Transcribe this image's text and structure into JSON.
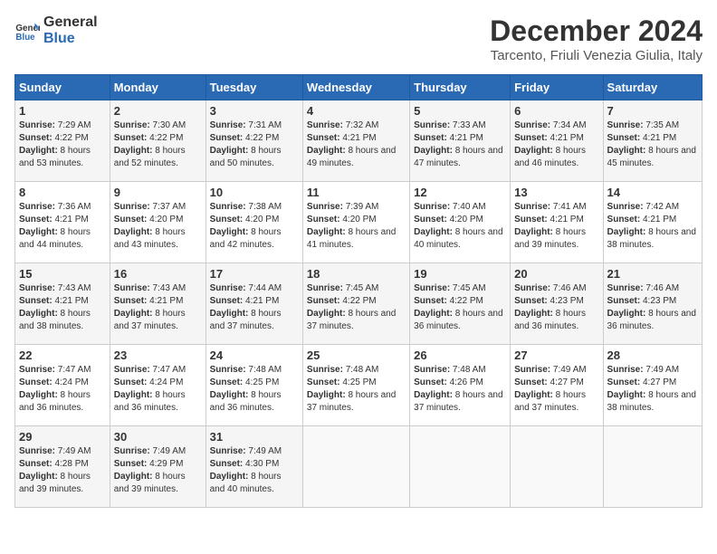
{
  "logo": {
    "line1": "General",
    "line2": "Blue"
  },
  "title": "December 2024",
  "subtitle": "Tarcento, Friuli Venezia Giulia, Italy",
  "days_header": [
    "Sunday",
    "Monday",
    "Tuesday",
    "Wednesday",
    "Thursday",
    "Friday",
    "Saturday"
  ],
  "weeks": [
    [
      {
        "day": "1",
        "sunrise": "7:29 AM",
        "sunset": "4:22 PM",
        "daylight": "8 hours and 53 minutes."
      },
      {
        "day": "2",
        "sunrise": "7:30 AM",
        "sunset": "4:22 PM",
        "daylight": "8 hours and 52 minutes."
      },
      {
        "day": "3",
        "sunrise": "7:31 AM",
        "sunset": "4:22 PM",
        "daylight": "8 hours and 50 minutes."
      },
      {
        "day": "4",
        "sunrise": "7:32 AM",
        "sunset": "4:21 PM",
        "daylight": "8 hours and 49 minutes."
      },
      {
        "day": "5",
        "sunrise": "7:33 AM",
        "sunset": "4:21 PM",
        "daylight": "8 hours and 47 minutes."
      },
      {
        "day": "6",
        "sunrise": "7:34 AM",
        "sunset": "4:21 PM",
        "daylight": "8 hours and 46 minutes."
      },
      {
        "day": "7",
        "sunrise": "7:35 AM",
        "sunset": "4:21 PM",
        "daylight": "8 hours and 45 minutes."
      }
    ],
    [
      {
        "day": "8",
        "sunrise": "7:36 AM",
        "sunset": "4:21 PM",
        "daylight": "8 hours and 44 minutes."
      },
      {
        "day": "9",
        "sunrise": "7:37 AM",
        "sunset": "4:20 PM",
        "daylight": "8 hours and 43 minutes."
      },
      {
        "day": "10",
        "sunrise": "7:38 AM",
        "sunset": "4:20 PM",
        "daylight": "8 hours and 42 minutes."
      },
      {
        "day": "11",
        "sunrise": "7:39 AM",
        "sunset": "4:20 PM",
        "daylight": "8 hours and 41 minutes."
      },
      {
        "day": "12",
        "sunrise": "7:40 AM",
        "sunset": "4:20 PM",
        "daylight": "8 hours and 40 minutes."
      },
      {
        "day": "13",
        "sunrise": "7:41 AM",
        "sunset": "4:21 PM",
        "daylight": "8 hours and 39 minutes."
      },
      {
        "day": "14",
        "sunrise": "7:42 AM",
        "sunset": "4:21 PM",
        "daylight": "8 hours and 38 minutes."
      }
    ],
    [
      {
        "day": "15",
        "sunrise": "7:43 AM",
        "sunset": "4:21 PM",
        "daylight": "8 hours and 38 minutes."
      },
      {
        "day": "16",
        "sunrise": "7:43 AM",
        "sunset": "4:21 PM",
        "daylight": "8 hours and 37 minutes."
      },
      {
        "day": "17",
        "sunrise": "7:44 AM",
        "sunset": "4:21 PM",
        "daylight": "8 hours and 37 minutes."
      },
      {
        "day": "18",
        "sunrise": "7:45 AM",
        "sunset": "4:22 PM",
        "daylight": "8 hours and 37 minutes."
      },
      {
        "day": "19",
        "sunrise": "7:45 AM",
        "sunset": "4:22 PM",
        "daylight": "8 hours and 36 minutes."
      },
      {
        "day": "20",
        "sunrise": "7:46 AM",
        "sunset": "4:23 PM",
        "daylight": "8 hours and 36 minutes."
      },
      {
        "day": "21",
        "sunrise": "7:46 AM",
        "sunset": "4:23 PM",
        "daylight": "8 hours and 36 minutes."
      }
    ],
    [
      {
        "day": "22",
        "sunrise": "7:47 AM",
        "sunset": "4:24 PM",
        "daylight": "8 hours and 36 minutes."
      },
      {
        "day": "23",
        "sunrise": "7:47 AM",
        "sunset": "4:24 PM",
        "daylight": "8 hours and 36 minutes."
      },
      {
        "day": "24",
        "sunrise": "7:48 AM",
        "sunset": "4:25 PM",
        "daylight": "8 hours and 36 minutes."
      },
      {
        "day": "25",
        "sunrise": "7:48 AM",
        "sunset": "4:25 PM",
        "daylight": "8 hours and 37 minutes."
      },
      {
        "day": "26",
        "sunrise": "7:48 AM",
        "sunset": "4:26 PM",
        "daylight": "8 hours and 37 minutes."
      },
      {
        "day": "27",
        "sunrise": "7:49 AM",
        "sunset": "4:27 PM",
        "daylight": "8 hours and 37 minutes."
      },
      {
        "day": "28",
        "sunrise": "7:49 AM",
        "sunset": "4:27 PM",
        "daylight": "8 hours and 38 minutes."
      }
    ],
    [
      {
        "day": "29",
        "sunrise": "7:49 AM",
        "sunset": "4:28 PM",
        "daylight": "8 hours and 39 minutes."
      },
      {
        "day": "30",
        "sunrise": "7:49 AM",
        "sunset": "4:29 PM",
        "daylight": "8 hours and 39 minutes."
      },
      {
        "day": "31",
        "sunrise": "7:49 AM",
        "sunset": "4:30 PM",
        "daylight": "8 hours and 40 minutes."
      },
      null,
      null,
      null,
      null
    ]
  ],
  "labels": {
    "sunrise": "Sunrise:",
    "sunset": "Sunset:",
    "daylight": "Daylight:"
  }
}
